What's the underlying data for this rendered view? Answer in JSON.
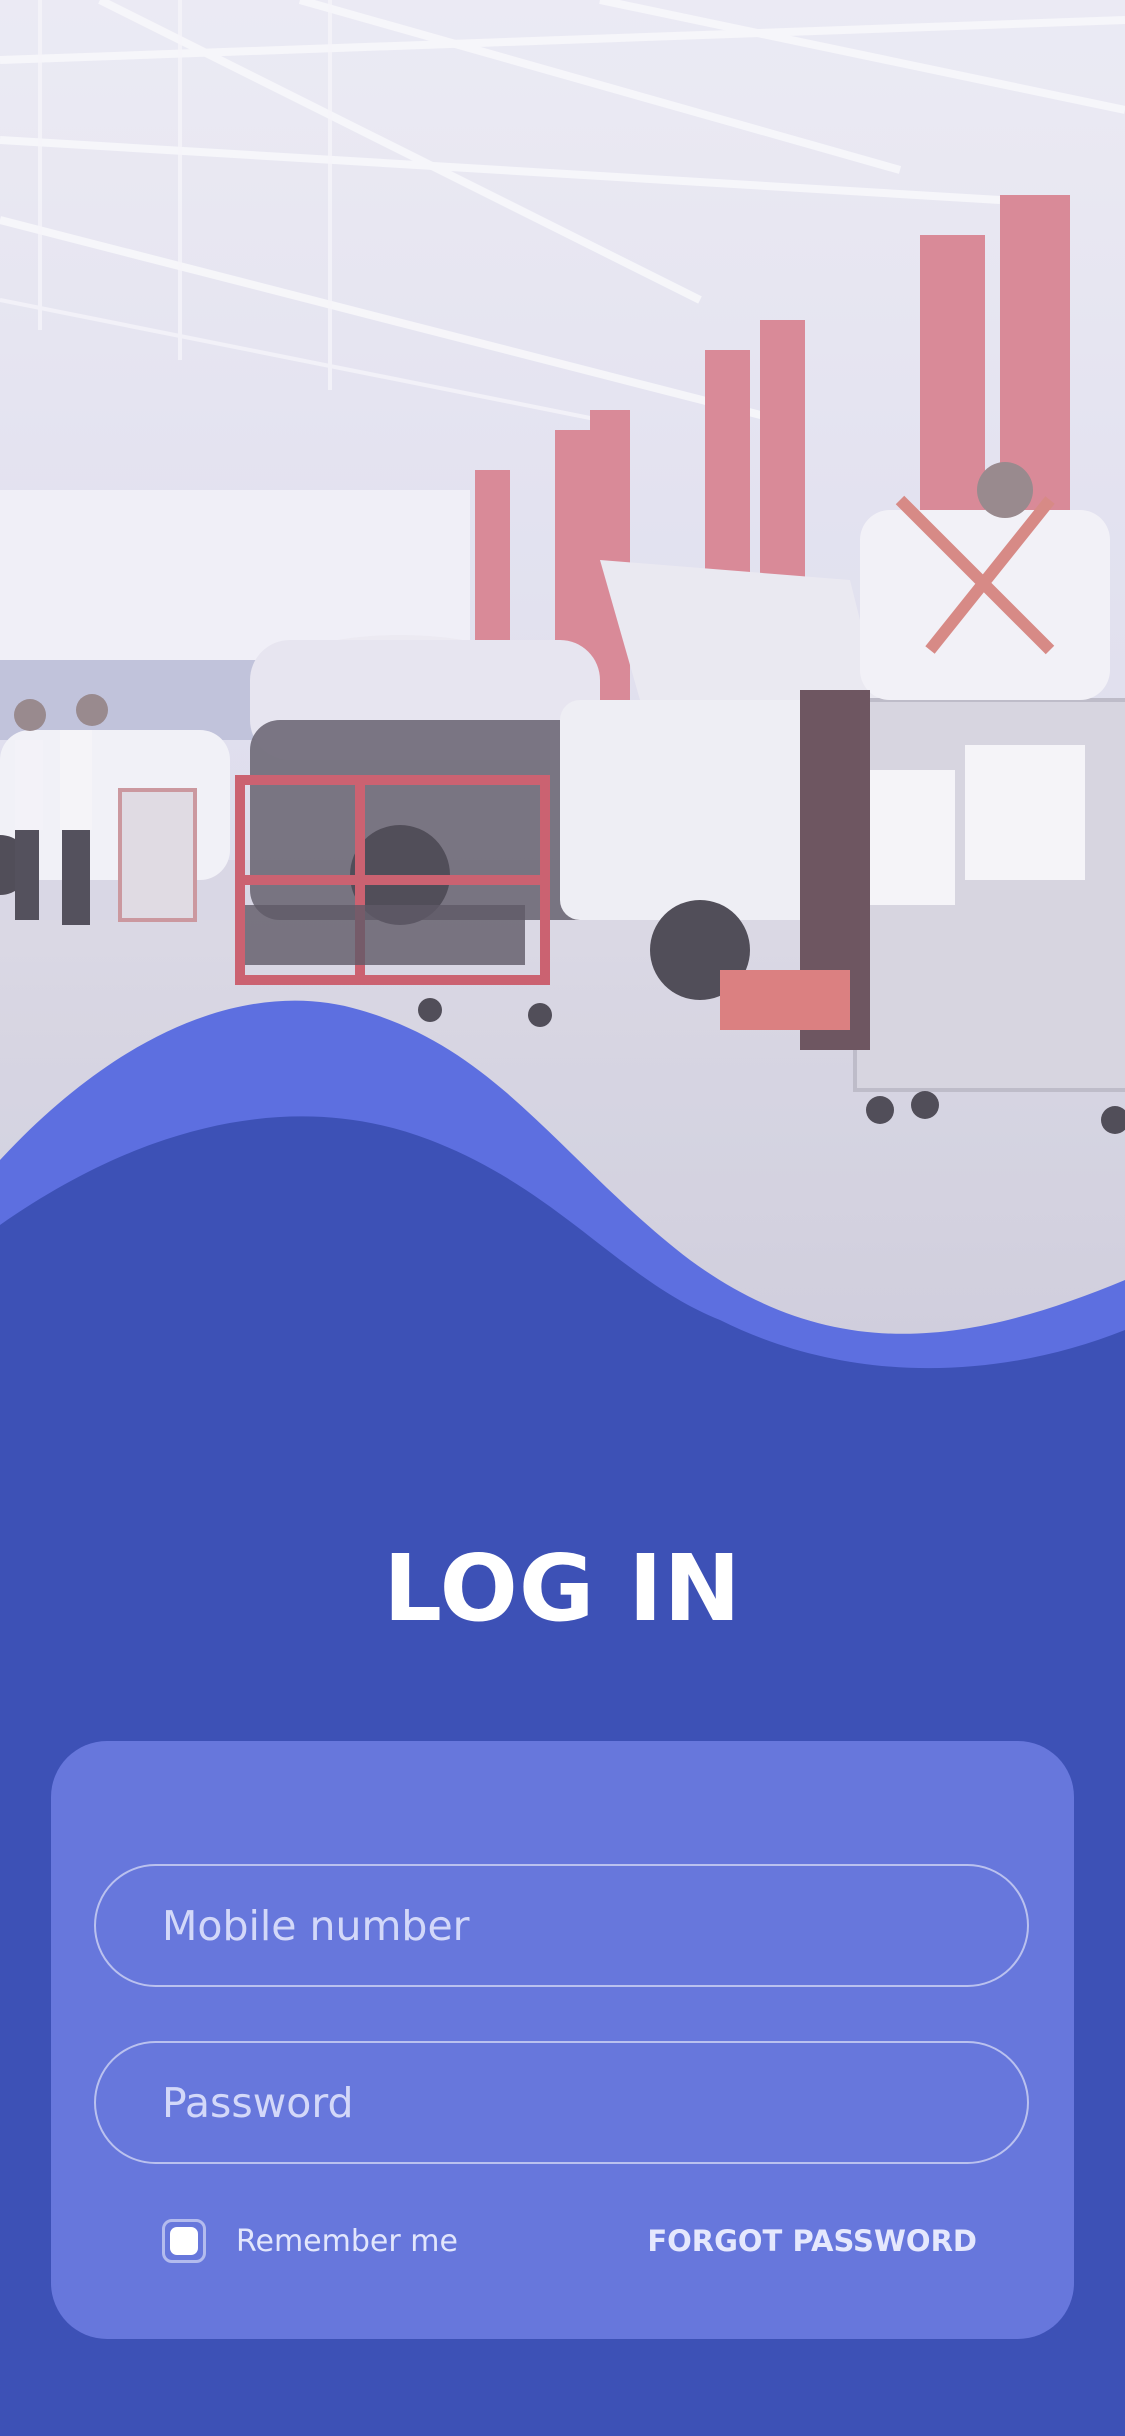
{
  "screen": {
    "background_color": "#3d51b6",
    "wave_color": "#5d6fe0"
  },
  "hero": {
    "image_subject": "auto repair workshop with mechanics and cars"
  },
  "title": "LOG IN",
  "login_card": {
    "background_color": "#6777dc",
    "mobile_field": {
      "placeholder": "Mobile number",
      "value": ""
    },
    "password_field": {
      "placeholder": "Password",
      "value": ""
    },
    "remember_me": {
      "label": "Remember me",
      "checked": false
    },
    "forgot_password_label": "FORGOT PASSWORD"
  }
}
